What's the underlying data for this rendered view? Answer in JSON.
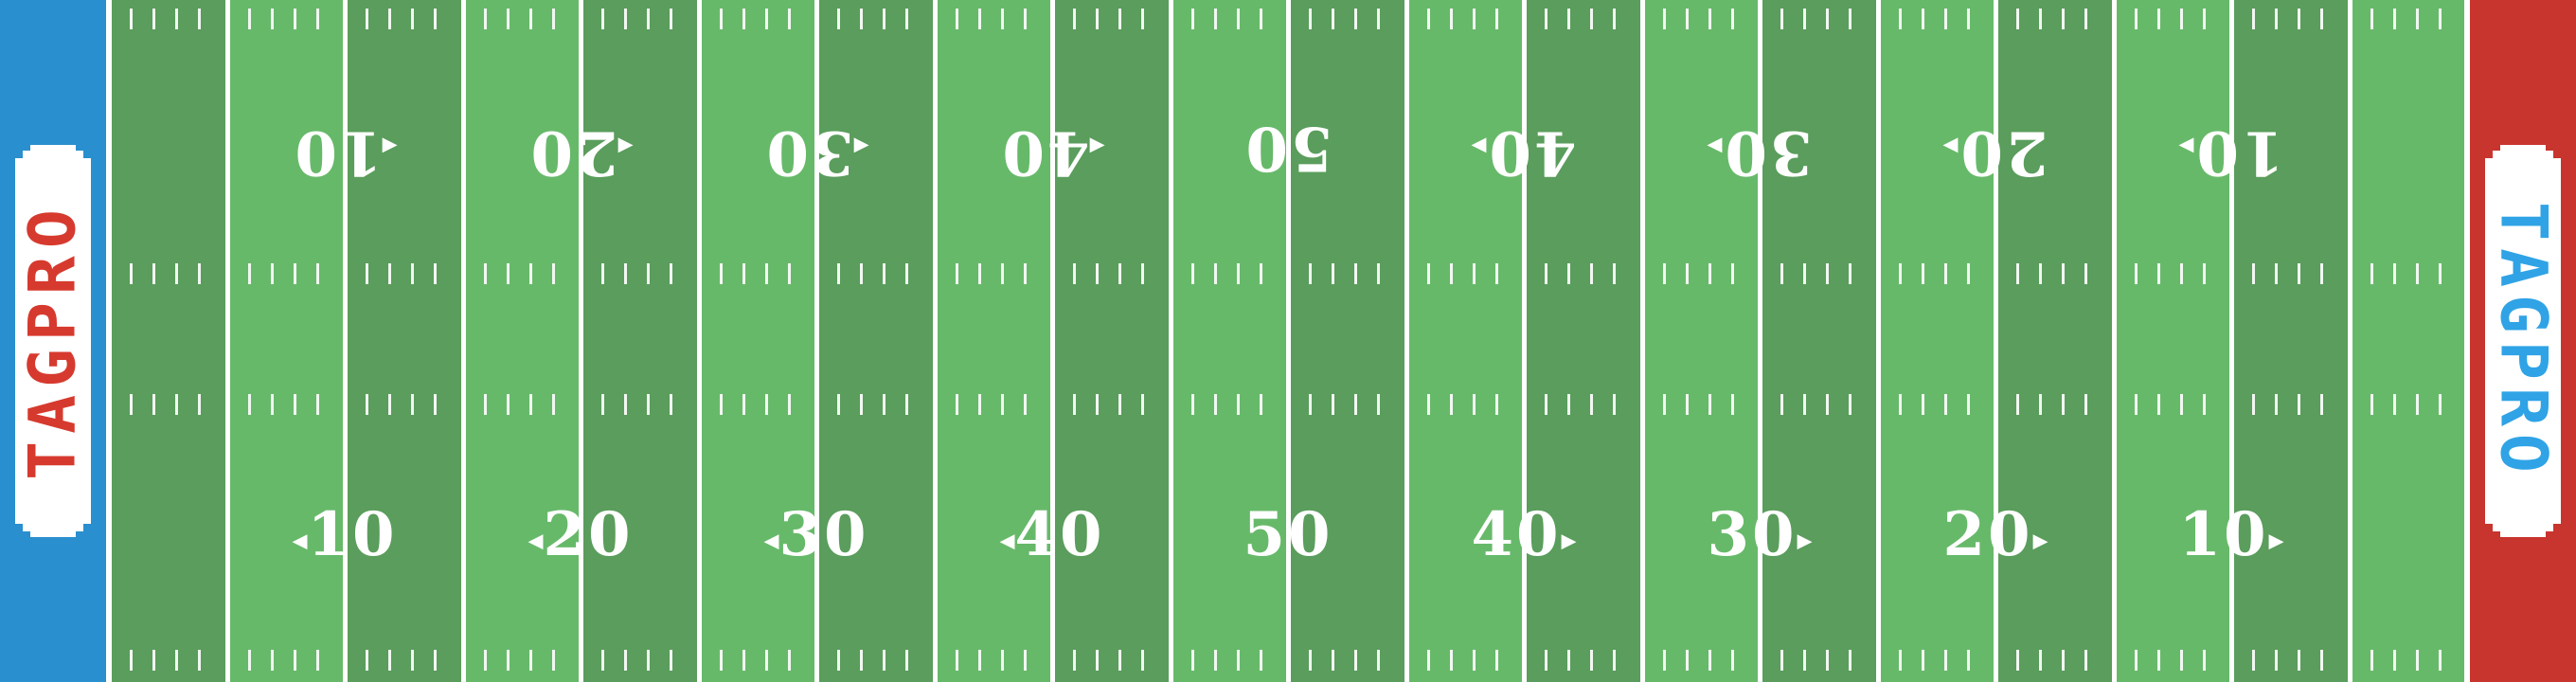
{
  "field": {
    "colors": {
      "stripe_light": "#67b96a",
      "stripe_dark": "#5a9d5c",
      "line": "#ffffff",
      "endzone_left": "#2a8fce",
      "endzone_right": "#c8352e",
      "logo_left_text": "#d63a2e",
      "logo_right_text": "#2fa3e6"
    },
    "endzones": {
      "left": {
        "logo": "TAGPRO"
      },
      "right": {
        "logo": "TAGPRO"
      }
    },
    "yard_numbers": [
      {
        "label": "10",
        "arrow": "left"
      },
      {
        "label": "20",
        "arrow": "left"
      },
      {
        "label": "30",
        "arrow": "left"
      },
      {
        "label": "40",
        "arrow": "left"
      },
      {
        "label": "50",
        "arrow": "none"
      },
      {
        "label": "40",
        "arrow": "right"
      },
      {
        "label": "30",
        "arrow": "right"
      },
      {
        "label": "20",
        "arrow": "right"
      },
      {
        "label": "10",
        "arrow": "right"
      }
    ]
  }
}
